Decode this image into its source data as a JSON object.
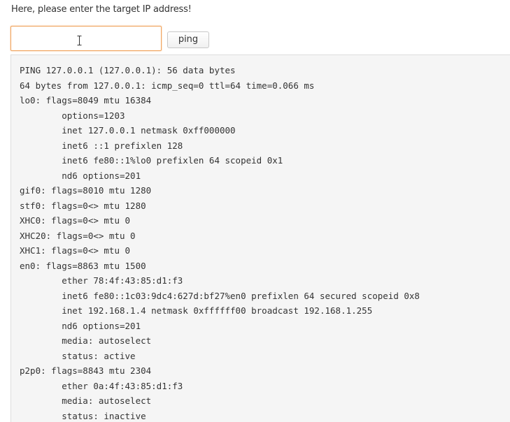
{
  "prompt_text": "Here, please enter the target IP address!",
  "ip_input": {
    "value": "",
    "placeholder": ""
  },
  "ping_button_label": "ping",
  "output_lines": [
    "PING 127.0.0.1 (127.0.0.1): 56 data bytes",
    "64 bytes from 127.0.0.1: icmp_seq=0 ttl=64 time=0.066 ms",
    "lo0: flags=8049 mtu 16384",
    "        options=1203",
    "        inet 127.0.0.1 netmask 0xff000000",
    "        inet6 ::1 prefixlen 128",
    "        inet6 fe80::1%lo0 prefixlen 64 scopeid 0x1",
    "        nd6 options=201",
    "gif0: flags=8010 mtu 1280",
    "stf0: flags=0<> mtu 1280",
    "XHC0: flags=0<> mtu 0",
    "XHC20: flags=0<> mtu 0",
    "XHC1: flags=0<> mtu 0",
    "en0: flags=8863 mtu 1500",
    "        ether 78:4f:43:85:d1:f3",
    "        inet6 fe80::1c03:9dc4:627d:bf27%en0 prefixlen 64 secured scopeid 0x8",
    "        inet 192.168.1.4 netmask 0xffffff00 broadcast 192.168.1.255",
    "        nd6 options=201",
    "        media: autoselect",
    "        status: active",
    "p2p0: flags=8843 mtu 2304",
    "        ether 0a:4f:43:85:d1:f3",
    "        media: autoselect",
    "        status: inactive"
  ]
}
